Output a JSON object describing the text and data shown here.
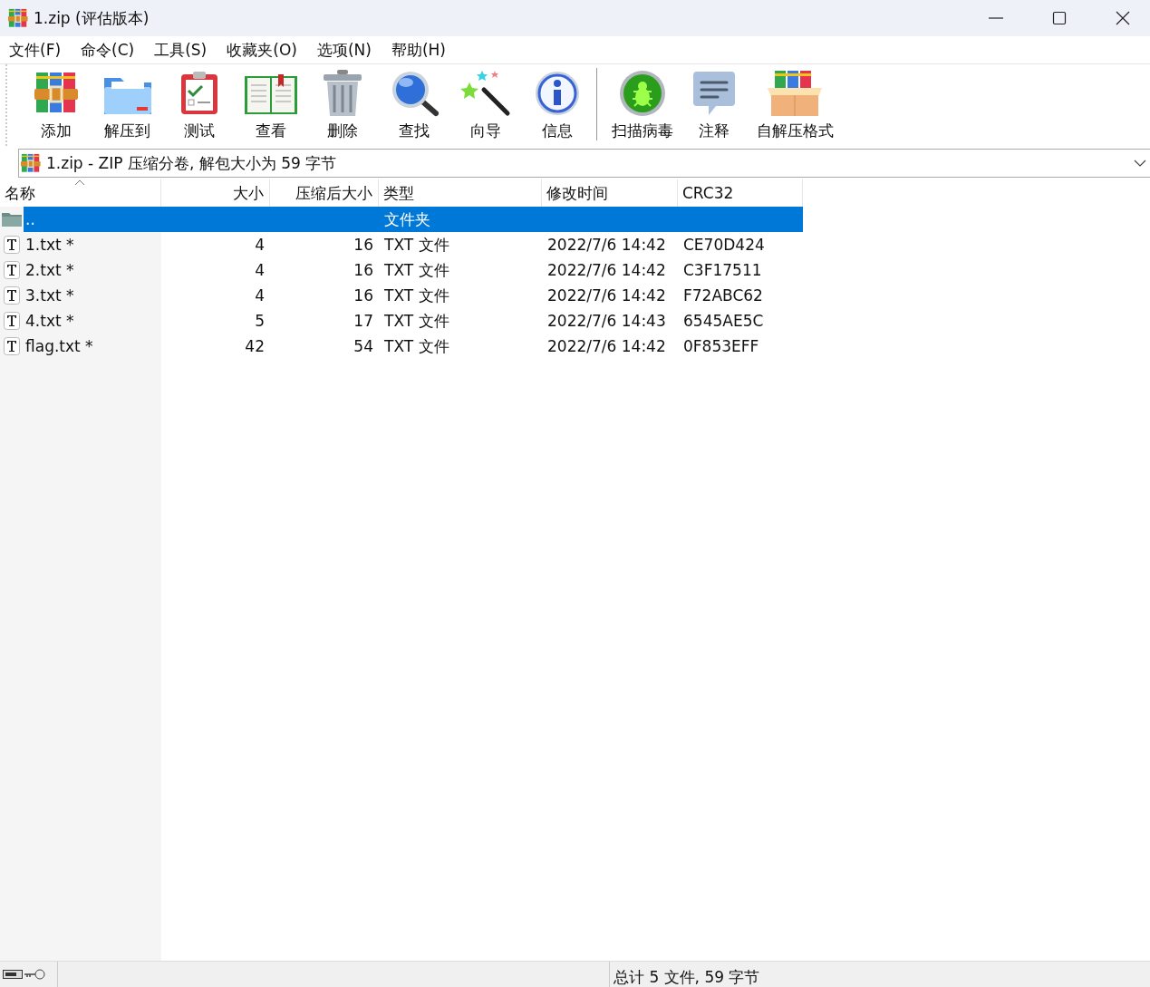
{
  "window": {
    "title": "1.zip (评估版本)"
  },
  "menu": [
    "文件(F)",
    "命令(C)",
    "工具(S)",
    "收藏夹(O)",
    "选项(N)",
    "帮助(H)"
  ],
  "toolbar": {
    "groups": [
      [
        {
          "kind": "add",
          "label": "添加"
        },
        {
          "kind": "extract",
          "label": "解压到"
        },
        {
          "kind": "test",
          "label": "测试"
        },
        {
          "kind": "view",
          "label": "查看"
        },
        {
          "kind": "delete",
          "label": "删除"
        },
        {
          "kind": "find",
          "label": "查找"
        },
        {
          "kind": "wizard",
          "label": "向导"
        },
        {
          "kind": "info",
          "label": "信息"
        }
      ],
      [
        {
          "kind": "scan",
          "label": "扫描病毒"
        },
        {
          "kind": "comment",
          "label": "注释"
        },
        {
          "kind": "sfx",
          "label": "自解压格式"
        }
      ]
    ]
  },
  "address_bar": {
    "text": "1.zip - ZIP 压缩分卷, 解包大小为 59 字节"
  },
  "table": {
    "columns": [
      {
        "label": "名称",
        "sorted": true
      },
      {
        "label": "大小",
        "sorted": false
      },
      {
        "label": "压缩后大小",
        "sorted": false
      },
      {
        "label": "类型",
        "sorted": false
      },
      {
        "label": "修改时间",
        "sorted": false
      },
      {
        "label": "CRC32",
        "sorted": false
      }
    ],
    "rows": [
      {
        "kind": "folder",
        "selected": true,
        "name": "..",
        "size": "",
        "packed": "",
        "type": "文件夹",
        "modified": "",
        "crc": ""
      },
      {
        "kind": "file",
        "selected": false,
        "name": "1.txt *",
        "size": "4",
        "packed": "16",
        "type": "TXT 文件",
        "modified": "2022/7/6 14:42",
        "crc": "CE70D424"
      },
      {
        "kind": "file",
        "selected": false,
        "name": "2.txt *",
        "size": "4",
        "packed": "16",
        "type": "TXT 文件",
        "modified": "2022/7/6 14:42",
        "crc": "C3F17511"
      },
      {
        "kind": "file",
        "selected": false,
        "name": "3.txt *",
        "size": "4",
        "packed": "16",
        "type": "TXT 文件",
        "modified": "2022/7/6 14:42",
        "crc": "F72ABC62"
      },
      {
        "kind": "file",
        "selected": false,
        "name": "4.txt *",
        "size": "5",
        "packed": "17",
        "type": "TXT 文件",
        "modified": "2022/7/6 14:43",
        "crc": "6545AE5C"
      },
      {
        "kind": "file",
        "selected": false,
        "name": "flag.txt *",
        "size": "42",
        "packed": "54",
        "type": "TXT 文件",
        "modified": "2022/7/6 14:42",
        "crc": "0F853EFF"
      }
    ]
  },
  "status_bar": {
    "text": "总计 5 文件, 59 字节"
  }
}
